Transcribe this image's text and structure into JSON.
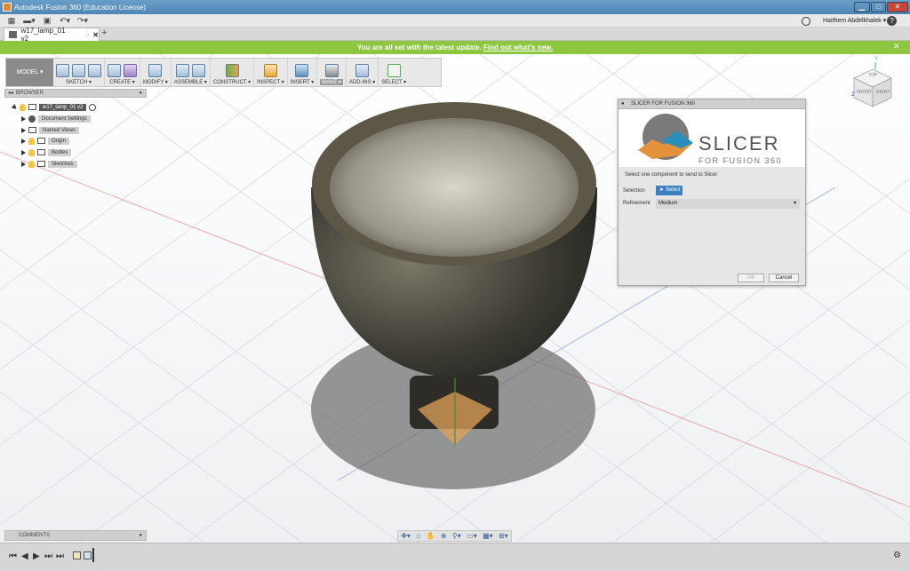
{
  "window": {
    "title": "Autodesk Fusion 360 (Education License)"
  },
  "toolbar": {
    "user": "Haithem Abdelkhalek ▾",
    "help": "?"
  },
  "tab": {
    "name": "w17_lamp_01 v2",
    "close": "✕",
    "add": "+"
  },
  "banner": {
    "text": "You are all set with the latest update.",
    "link": "Find out what's new."
  },
  "ribbon": {
    "mode": "MODEL ▾",
    "groups": [
      {
        "label": "SKETCH ▾"
      },
      {
        "label": "CREATE ▾"
      },
      {
        "label": "MODIFY ▾"
      },
      {
        "label": "ASSEMBLE ▾"
      },
      {
        "label": "CONSTRUCT ▾"
      },
      {
        "label": "INSPECT ▾"
      },
      {
        "label": "INSERT ▾"
      },
      {
        "label": "MAKE ▾"
      },
      {
        "label": "ADD-INS ▾"
      },
      {
        "label": "SELECT ▾"
      }
    ]
  },
  "browser": {
    "title": "BROWSER",
    "root": "w17_lamp_01 v2",
    "items": [
      "Document Settings",
      "Named Views",
      "Origin",
      "Bodies",
      "Sketches"
    ]
  },
  "comments": {
    "title": "COMMENTS"
  },
  "dialog": {
    "title": "SLICER FOR FUSION 360",
    "logo": "SLICER",
    "logo_sub": "FOR FUSION 360",
    "instruction": "Select one component to send to Slicer",
    "selection_label": "Selection",
    "select_button": "Select",
    "refinement_label": "Refinement",
    "refinement_value": "Medium",
    "ok": "OK",
    "cancel": "Cancel"
  },
  "viewcube": {
    "top": "TOP",
    "front": "FRONT",
    "right": "RIGHT",
    "axes": {
      "y": "Y",
      "z": "Z"
    }
  },
  "colors": {
    "banner": "#8dc63f",
    "accent": "#3a7fc0",
    "bowl": "#3b3a33",
    "rim": "#6e6655"
  }
}
